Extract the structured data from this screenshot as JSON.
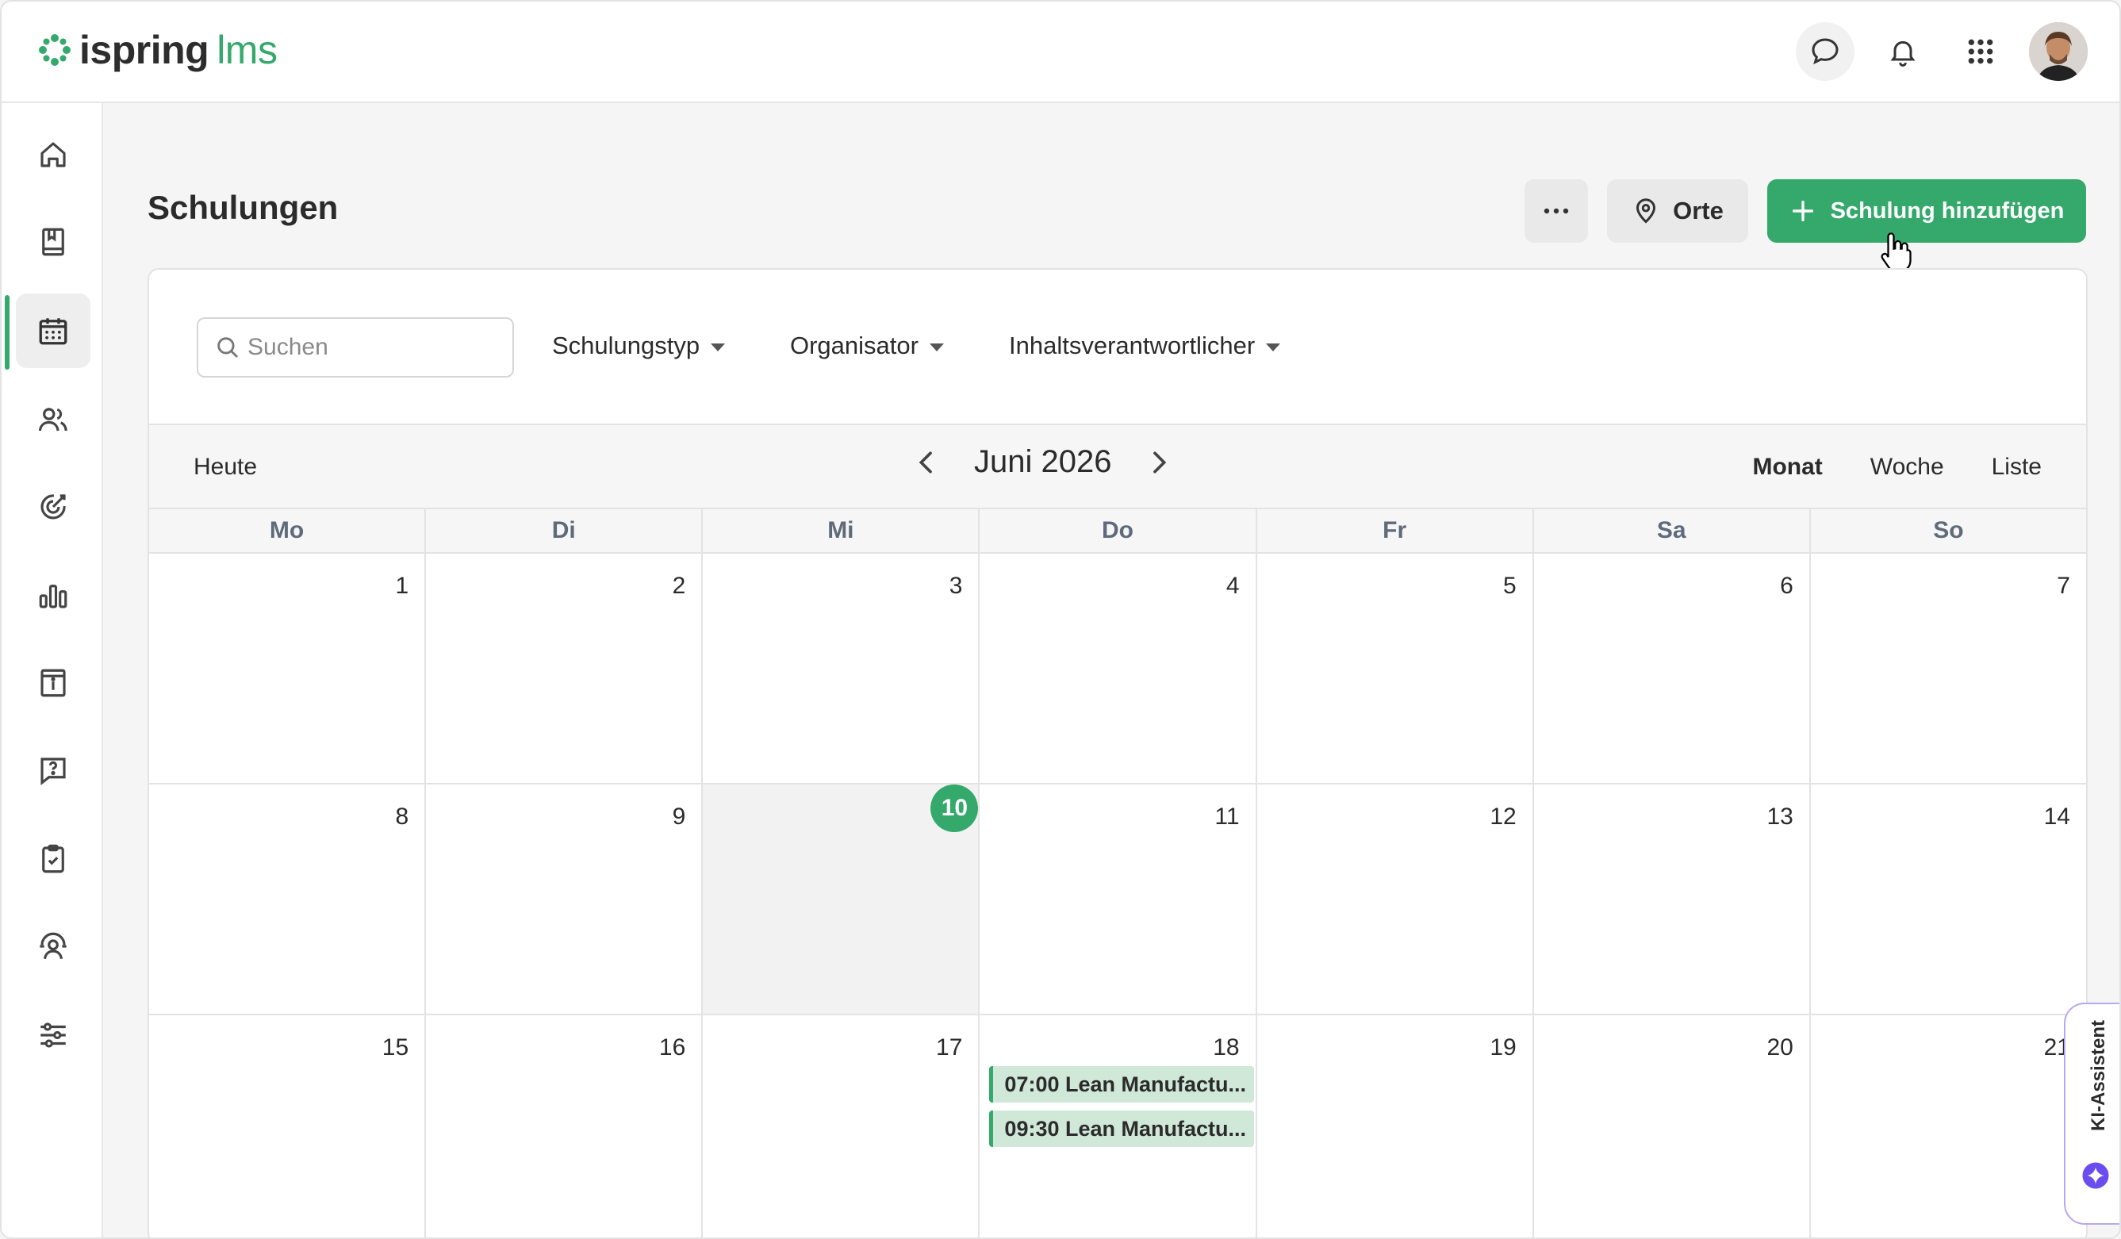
{
  "brand": {
    "name_main": "ispring",
    "name_suffix": "lms",
    "accent_color": "#34a96b"
  },
  "topbar": {
    "icons": [
      "chat-icon",
      "bell-icon",
      "apps-grid-icon"
    ],
    "avatar": "user-avatar"
  },
  "sidebar": {
    "items": [
      {
        "icon": "home-icon"
      },
      {
        "icon": "courses-book-icon"
      },
      {
        "icon": "calendar-icon",
        "active": true
      },
      {
        "icon": "users-icon"
      },
      {
        "icon": "target-icon"
      },
      {
        "icon": "reports-chart-icon"
      },
      {
        "icon": "info-board-icon"
      },
      {
        "icon": "help-chat-icon"
      },
      {
        "icon": "tasks-clipboard-icon"
      },
      {
        "icon": "coaching-icon"
      },
      {
        "icon": "settings-sliders-icon"
      }
    ]
  },
  "page": {
    "title": "Schulungen",
    "more_label": "···",
    "orte_label": "Orte",
    "add_label": "Schulung hinzufügen"
  },
  "filters": {
    "search_placeholder": "Suchen",
    "dropdowns": [
      "Schulungstyp",
      "Organisator",
      "Inhaltsverantwortlicher"
    ]
  },
  "calendar": {
    "today_label": "Heute",
    "month_label": "Juni 2026",
    "views": [
      "Monat",
      "Woche",
      "Liste"
    ],
    "active_view": "Monat",
    "weekdays": [
      "Mo",
      "Di",
      "Mi",
      "Do",
      "Fr",
      "Sa",
      "So"
    ],
    "weeks": [
      [
        "1",
        "2",
        "3",
        "4",
        "5",
        "6",
        "7"
      ],
      [
        "8",
        "9",
        "10",
        "11",
        "12",
        "13",
        "14"
      ],
      [
        "15",
        "16",
        "17",
        "18",
        "19",
        "20",
        "21"
      ]
    ],
    "today": "10",
    "events": [
      {
        "day": "18",
        "text": "07:00 Lean Manufactu..."
      },
      {
        "day": "18",
        "text": "09:30 Lean Manufactu..."
      }
    ]
  },
  "assistant": {
    "label": "KI-Assistent"
  }
}
